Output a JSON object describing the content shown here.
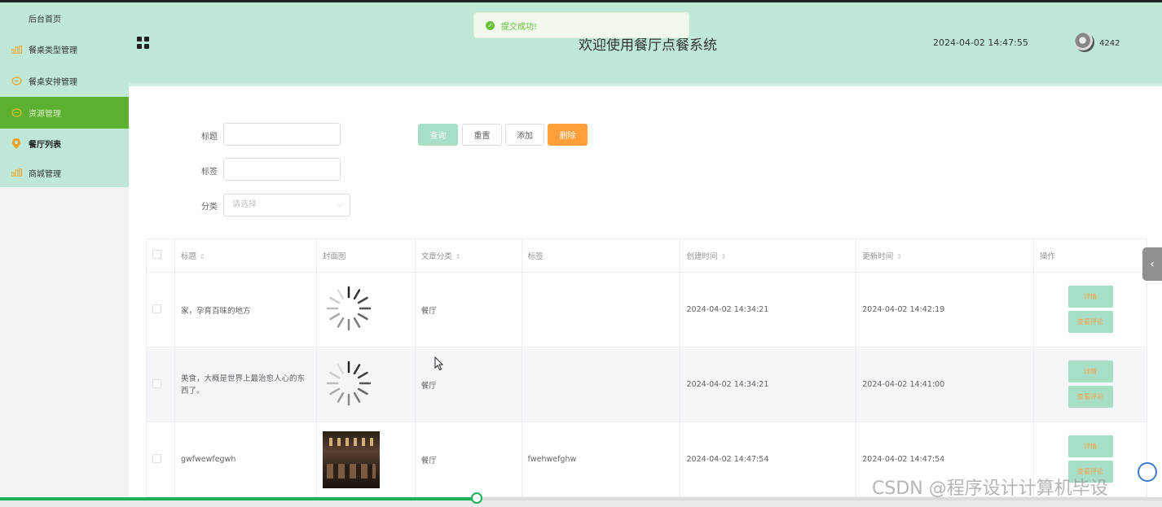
{
  "sidebar": {
    "items": [
      {
        "label": "后台首页",
        "icon": "none"
      },
      {
        "label": "餐桌类型管理",
        "icon": "bar-chart-icon"
      },
      {
        "label": "餐桌安排管理",
        "icon": "chat-icon"
      },
      {
        "label": "资源管理",
        "icon": "chat-icon"
      },
      {
        "label": "餐厅列表",
        "icon": "location-pin-icon"
      },
      {
        "label": "商城管理",
        "icon": "bar-chart-icon"
      }
    ]
  },
  "header": {
    "title": "欢迎使用餐厅点餐系统",
    "datetime": "2024-04-02 14:47:55",
    "username": "4242"
  },
  "toast": {
    "message": "提交成功!"
  },
  "filters": {
    "title_label": "标题",
    "tag_label": "标签",
    "category_label": "分类",
    "category_placeholder": "请选择",
    "buttons": {
      "query": "查询",
      "reset": "重置",
      "add": "添加",
      "delete": "删除"
    }
  },
  "table": {
    "columns": [
      "标题",
      "封面图",
      "文章分类",
      "标签",
      "创建时间",
      "更新时间",
      "操作"
    ],
    "rows": [
      {
        "title": "家，孕育百味的地方",
        "cover": "loading",
        "category": "餐厅",
        "tag": "",
        "created": "2024-04-02 14:34:21",
        "updated": "2024-04-02 14:42:19"
      },
      {
        "title": "美食，大概是世界上最治愈人心的东西了。",
        "cover": "loading",
        "category": "餐厅",
        "tag": "",
        "created": "2024-04-02 14:34:21",
        "updated": "2024-04-02 14:41:00"
      },
      {
        "title": "gwfwewfegwh",
        "cover": "image",
        "category": "餐厅",
        "tag": "fwehwefghw",
        "created": "2024-04-02 14:47:54",
        "updated": "2024-04-02 14:47:54"
      }
    ],
    "actions": {
      "detail": "详情",
      "comments": "查看评论"
    }
  },
  "video_progress": 0.41,
  "watermark": "CSDN @程序设计计算机毕设",
  "colors": {
    "accent": "#bfe8d6",
    "active_menu": "#5cb030",
    "delete_button": "#ff9f3a",
    "query_button": "#a6dfc5"
  }
}
